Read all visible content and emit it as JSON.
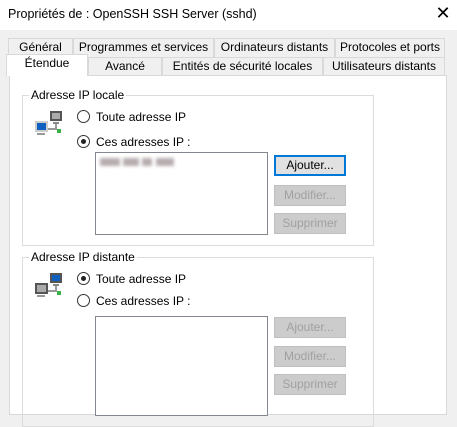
{
  "window": {
    "title": "Propriétés de : OpenSSH SSH Server (sshd)",
    "close_label": "✕"
  },
  "tabs_row1": [
    "Général",
    "Programmes et services",
    "Ordinateurs distants",
    "Protocoles et ports"
  ],
  "tabs_row2": [
    "Étendue",
    "Avancé",
    "Entités de sécurité locales",
    "Utilisateurs distants"
  ],
  "selected_tab": "Étendue",
  "local": {
    "label": "Adresse IP locale",
    "option_any": "Toute adresse IP",
    "option_these": "Ces adresses IP :",
    "selected": "these",
    "buttons": {
      "add": "Ajouter...",
      "edit": "Modifier...",
      "remove": "Supprimer"
    }
  },
  "remote": {
    "label": "Adresse IP distante",
    "option_any": "Toute adresse IP",
    "option_these": "Ces adresses IP :",
    "selected": "any",
    "buttons": {
      "add": "Ajouter...",
      "edit": "Modifier...",
      "remove": "Supprimer"
    }
  }
}
